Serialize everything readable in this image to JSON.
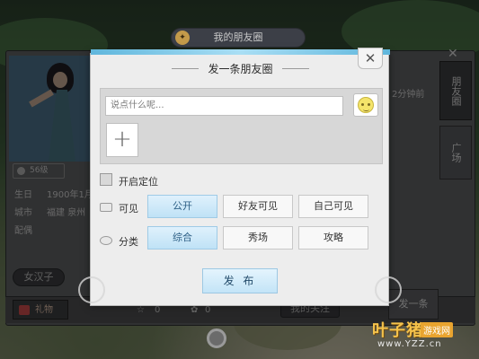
{
  "top_tab": {
    "title": "我的朋友圈",
    "icon": "badge-icon"
  },
  "background": {
    "level": "56级",
    "time_ago": "2分钟前",
    "birthday_label": "生日",
    "birthday_value": "1900年1月",
    "city_label": "城市",
    "city_value": "福建 泉州",
    "spouse_label": "配偶",
    "tag": "女汉子",
    "gift_label": "礼物",
    "like_count": "0",
    "flower_count": "0",
    "my_follow": "我的关注",
    "post_button": "发一条",
    "right_tabs": [
      "朋友圈",
      "广场"
    ]
  },
  "dialog": {
    "title": "发一条朋友圈",
    "input_placeholder": "说点什么呢...",
    "add_symbol": "+",
    "location_label": "开启定位",
    "visibility_label": "可见",
    "visibility_options": [
      "公开",
      "好友可见",
      "自己可见"
    ],
    "visibility_selected": 0,
    "category_label": "分类",
    "category_options": [
      "综合",
      "秀场",
      "攻略"
    ],
    "category_selected": 0,
    "publish_label": "发 布",
    "close_symbol": "✕"
  },
  "watermark": {
    "brand": "叶子猪",
    "tag": "游戏网",
    "url": "www.YZZ.cn"
  }
}
